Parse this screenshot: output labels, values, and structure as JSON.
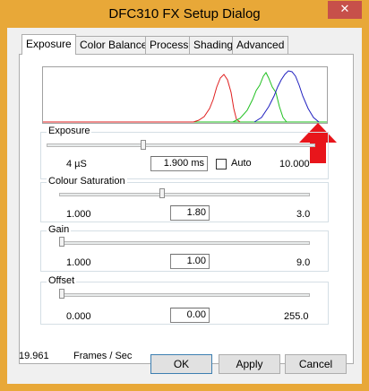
{
  "window": {
    "title": "DFC310 FX Setup Dialog",
    "close_glyph": "✕"
  },
  "tabs": [
    {
      "label": "Exposure"
    },
    {
      "label": "Color Balance"
    },
    {
      "label": "Process"
    },
    {
      "label": "Shading"
    },
    {
      "label": "Advanced"
    }
  ],
  "exposure": {
    "label": "Exposure",
    "min": "4  µS",
    "value": "1.900 ms",
    "auto_label": "Auto",
    "max": "10.000"
  },
  "saturation": {
    "label": "Colour Saturation",
    "min": "1.000",
    "value": "1.80",
    "max": "3.0"
  },
  "gain": {
    "label": "Gain",
    "min": "1.000",
    "value": "1.00",
    "max": "9.0"
  },
  "offset": {
    "label": "Offset",
    "min": "0.000",
    "value": "0.00",
    "max": "255.0"
  },
  "status": {
    "fps_value": "19.961",
    "fps_unit": "Frames / Sec"
  },
  "buttons": {
    "ok": "OK",
    "apply": "Apply",
    "cancel": "Cancel"
  },
  "colors": {
    "titlebar": "#e8a838",
    "close": "#c7504a",
    "hist_red": "#e02020",
    "hist_green": "#20c020",
    "hist_blue": "#2020c0",
    "arrow": "#e8151b"
  }
}
